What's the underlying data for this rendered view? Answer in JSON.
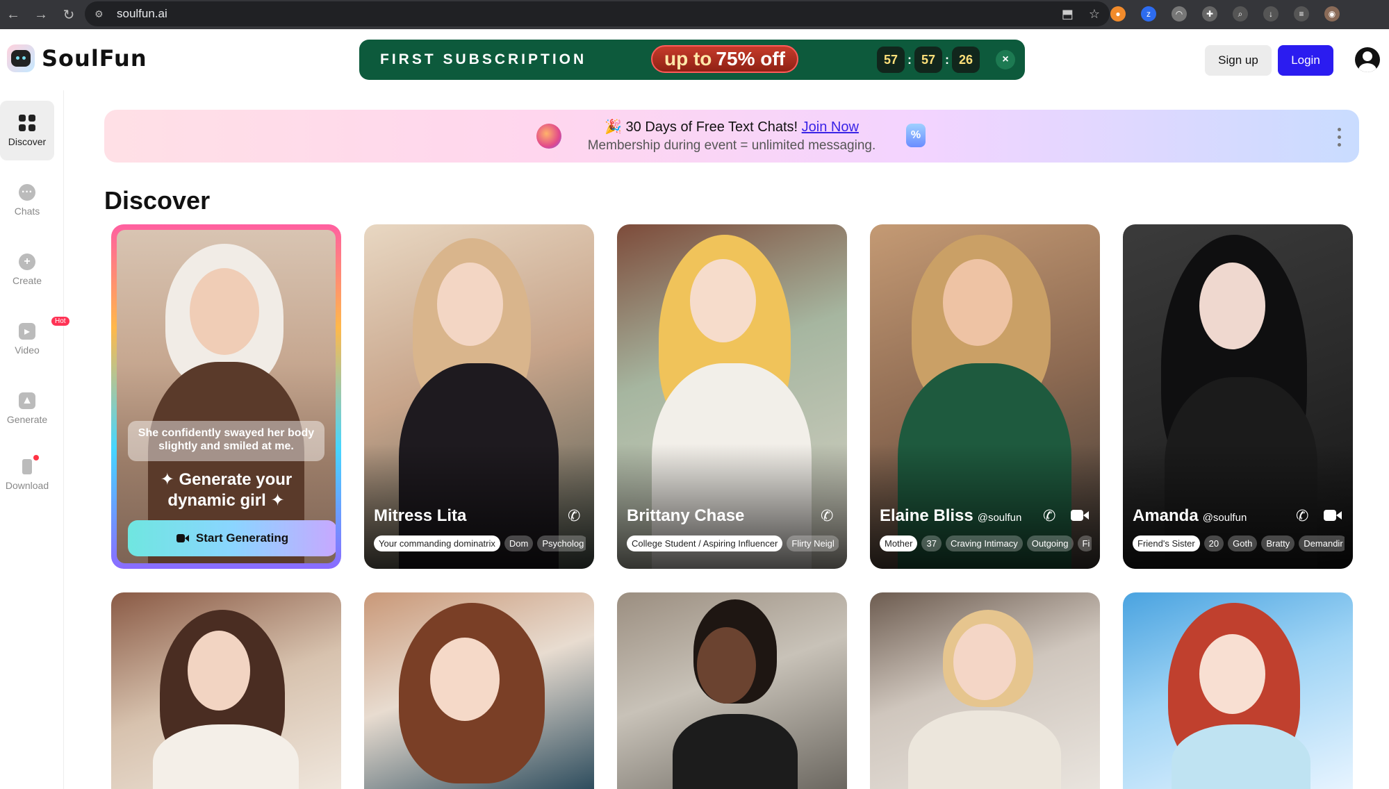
{
  "browser": {
    "url": "soulfun.ai"
  },
  "header": {
    "logo_text": "SoulFun",
    "promo": {
      "title": "FIRST SUBSCRIPTION",
      "offer_prefix": "up to",
      "offer_value": "75% off",
      "timer": [
        "57",
        "57",
        "26"
      ],
      "timer_sep": ":",
      "close": "×"
    },
    "signup_label": "Sign up",
    "login_label": "Login"
  },
  "sidebar": {
    "items": [
      {
        "label": "Discover"
      },
      {
        "label": "Chats"
      },
      {
        "label": "Create"
      },
      {
        "label": "Video",
        "badge": "Hot"
      },
      {
        "label": "Generate"
      },
      {
        "label": "Download"
      }
    ]
  },
  "banner": {
    "line1": "🎉 30 Days of Free Text Chats!",
    "link": "Join Now",
    "line2": "Membership during event = unlimited messaging."
  },
  "main": {
    "title": "Discover",
    "generate_card": {
      "quote": "She confidently swayed her body slightly and smiled at me.",
      "title_line1": "✦ Generate your",
      "title_line2": "dynamic girl ✦",
      "button": "Start Generating"
    },
    "cards": [
      {
        "name": "Mitress Lita",
        "handle": "",
        "video": false,
        "tags": [
          "Your commanding dominatrix",
          "Dom",
          "Psycholog"
        ]
      },
      {
        "name": "Brittany Chase",
        "handle": "",
        "video": false,
        "tags": [
          "College Student / Aspiring Influencer",
          "Flirty Neigl"
        ]
      },
      {
        "name": "Elaine Bliss",
        "handle": "@soulfun",
        "video": true,
        "tags": [
          "Mother",
          "37",
          "Craving Intimacy",
          "Outgoing",
          "Fi"
        ]
      },
      {
        "name": "Amanda",
        "handle": "@soulfun",
        "video": true,
        "tags": [
          "Friend's Sister",
          "20",
          "Goth",
          "Bratty",
          "Demandir"
        ]
      }
    ]
  }
}
